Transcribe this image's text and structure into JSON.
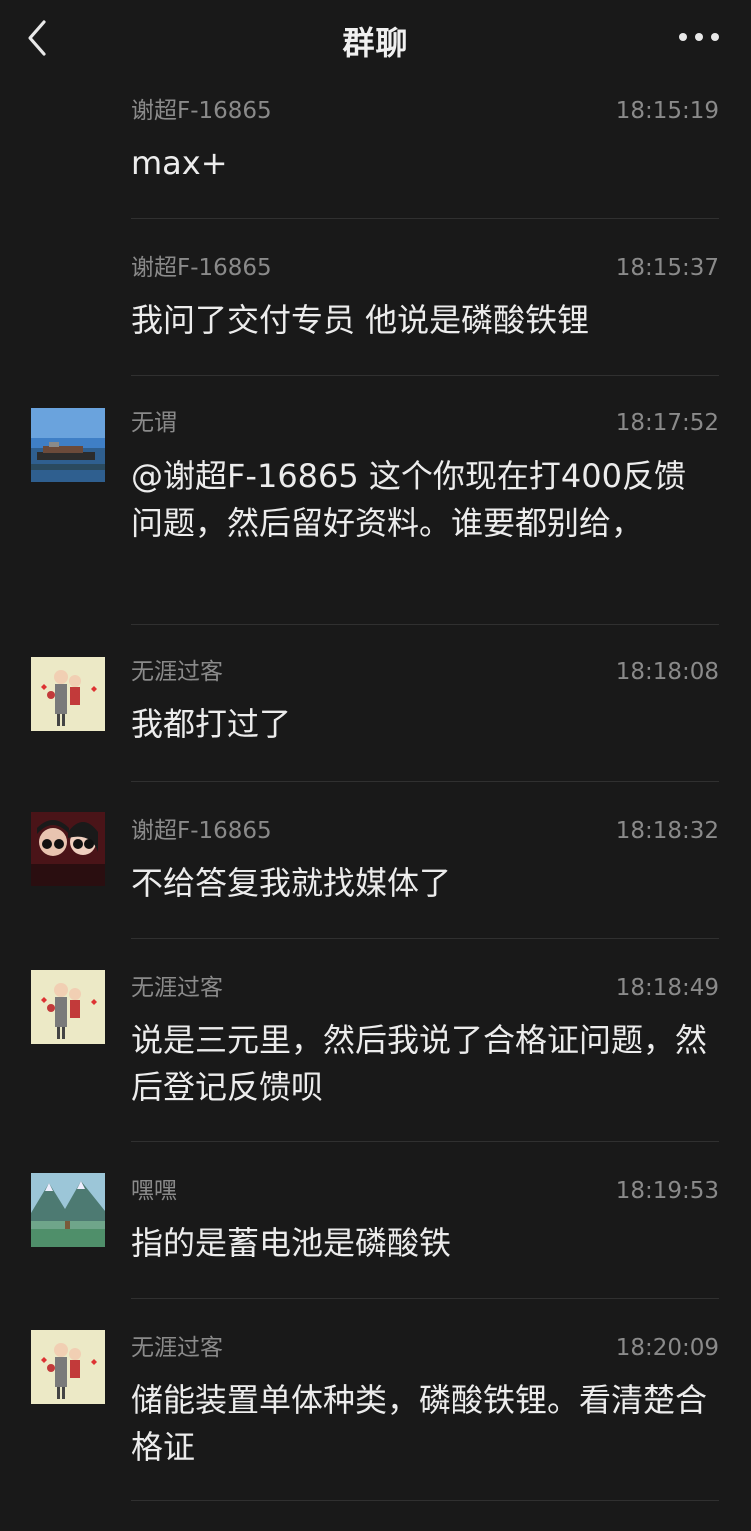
{
  "header": {
    "title": "群聊",
    "back_icon": "chevron-left-icon",
    "more_icon": "more-dots-icon"
  },
  "messages": [
    {
      "sender": "谢超F-16865",
      "time": "18:15:19",
      "text": "max+",
      "avatar": "none"
    },
    {
      "sender": "谢超F-16865",
      "time": "18:15:37",
      "text": "我问了交付专员 他说是磷酸铁锂",
      "avatar": "none"
    },
    {
      "sender": "无谓",
      "time": "18:17:52",
      "text": "@谢超F-16865 这个你现在打400反馈问题，然后留好资料。谁要都别给，",
      "avatar": "ship-photo"
    },
    {
      "sender": "无涯过客",
      "time": "18:18:08",
      "text": "我都打过了",
      "avatar": "cartoon-family"
    },
    {
      "sender": "谢超F-16865",
      "time": "18:18:32",
      "text": "不给答复我就找媒体了",
      "avatar": "couple-photo"
    },
    {
      "sender": "无涯过客",
      "time": "18:18:49",
      "text": "说是三元里，然后我说了合格证问题，然后登记反馈呗",
      "avatar": "cartoon-family"
    },
    {
      "sender": "嘿嘿",
      "time": "18:19:53",
      "text": "指的是蓄电池是磷酸铁",
      "avatar": "mountain-lake"
    },
    {
      "sender": "无涯过客",
      "time": "18:20:09",
      "text": "储能装置单体种类，磷酸铁锂。看清楚合格证",
      "avatar": "cartoon-family"
    }
  ],
  "colors": {
    "background": "#191919",
    "text": "#ececec",
    "meta": "#8a8a8a",
    "divider": "#303030"
  }
}
